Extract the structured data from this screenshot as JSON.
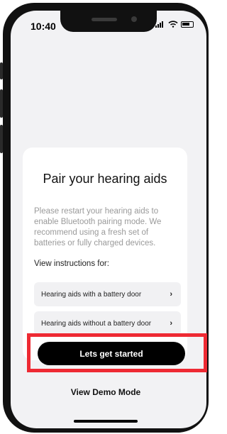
{
  "status_bar": {
    "time": "10:40"
  },
  "pairing": {
    "title": "Pair your hearing aids",
    "description": "Please restart your hearing aids to enable Bluetooth pairing mode. We recommend using a fresh set of batteries or fully charged devices.",
    "view_instructions_label": "View instructions for:",
    "options": [
      {
        "label": "Hearing aids with a battery door"
      },
      {
        "label": "Hearing aids without a battery door"
      }
    ]
  },
  "actions": {
    "primary_label": "Lets get started",
    "demo_label": "View Demo Mode"
  },
  "colors": {
    "highlight": "#ee2a33",
    "primary_button": "#000000",
    "screen_bg": "#f2f2f4"
  },
  "icons": {
    "option_chevron": "chevron-right-icon"
  }
}
